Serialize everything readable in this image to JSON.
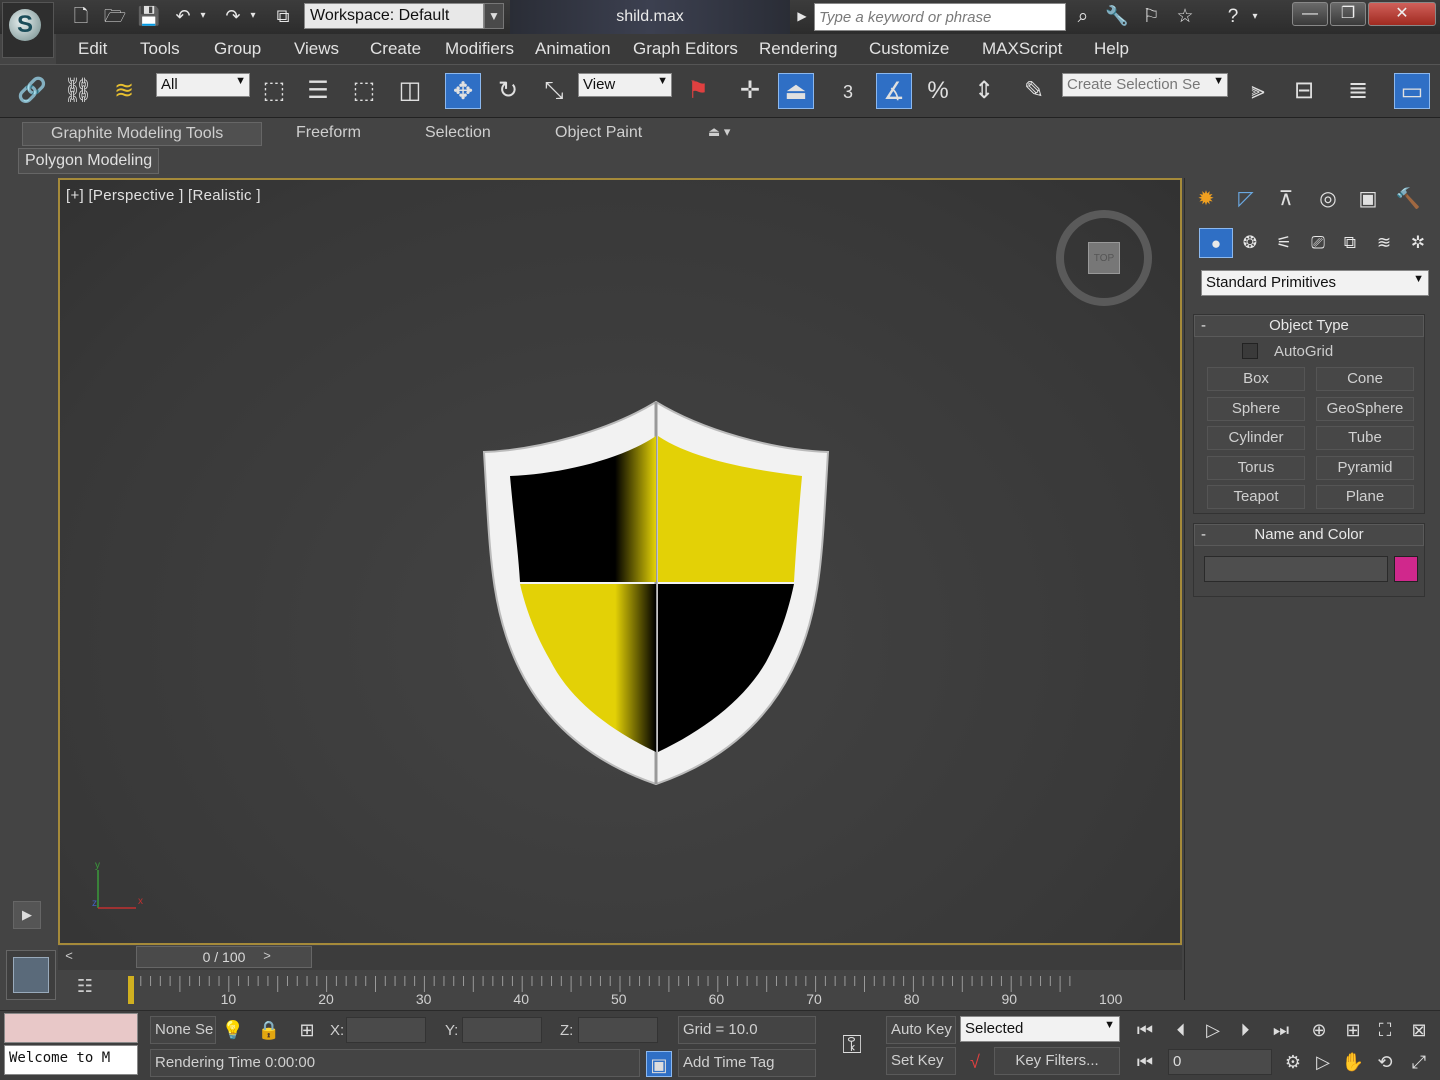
{
  "titlebar": {
    "workspace_label": "Workspace: Default",
    "filename": "shild.max",
    "search_placeholder": "Type a keyword or phrase"
  },
  "menu": [
    "Edit",
    "Tools",
    "Group",
    "Views",
    "Create",
    "Modifiers",
    "Animation",
    "Graph Editors",
    "Rendering",
    "Customize",
    "MAXScript",
    "Help"
  ],
  "toolbar": {
    "selection_filter": "All",
    "ref_coord": "View",
    "snap_label": "3",
    "named_selection_placeholder": "Create Selection Se"
  },
  "ribbon": {
    "tabs": [
      "Graphite Modeling Tools",
      "Freeform",
      "Selection",
      "Object Paint"
    ],
    "panel": "Polygon Modeling"
  },
  "viewport": {
    "label": "[+] [Perspective ] [Realistic ]",
    "viewcube_face": "TOP",
    "axis": {
      "x": "x",
      "y": "y",
      "z": "z"
    },
    "colors": {
      "yellow": "#e3d106",
      "black": "#000000",
      "rim": "#f2f2f2"
    }
  },
  "command_panel": {
    "category": "Standard Primitives",
    "object_type_title": "Object Type",
    "autogrid": "AutoGrid",
    "autogrid_checked": false,
    "buttons": [
      "Box",
      "Cone",
      "Sphere",
      "GeoSphere",
      "Cylinder",
      "Tube",
      "Torus",
      "Pyramid",
      "Teapot",
      "Plane"
    ],
    "name_color_title": "Name and Color",
    "object_name": "",
    "object_color": "#d0288c"
  },
  "timeline": {
    "frame_display": "0 / 100",
    "ticks": [
      "10",
      "20",
      "30",
      "40",
      "50",
      "60",
      "70",
      "80",
      "90",
      "100"
    ]
  },
  "status": {
    "selection": "None Se",
    "x_label": "X:",
    "y_label": "Y:",
    "z_label": "Z:",
    "grid": "Grid = 10.0",
    "rendering_time": "Rendering Time  0:00:00",
    "add_time_tag": "Add Time Tag",
    "auto_key": "Auto Key",
    "key_mode": "Selected",
    "set_key": "Set Key",
    "key_filters": "Key Filters...",
    "current_frame": "0",
    "maxscript_listener": "Welcome to M"
  }
}
